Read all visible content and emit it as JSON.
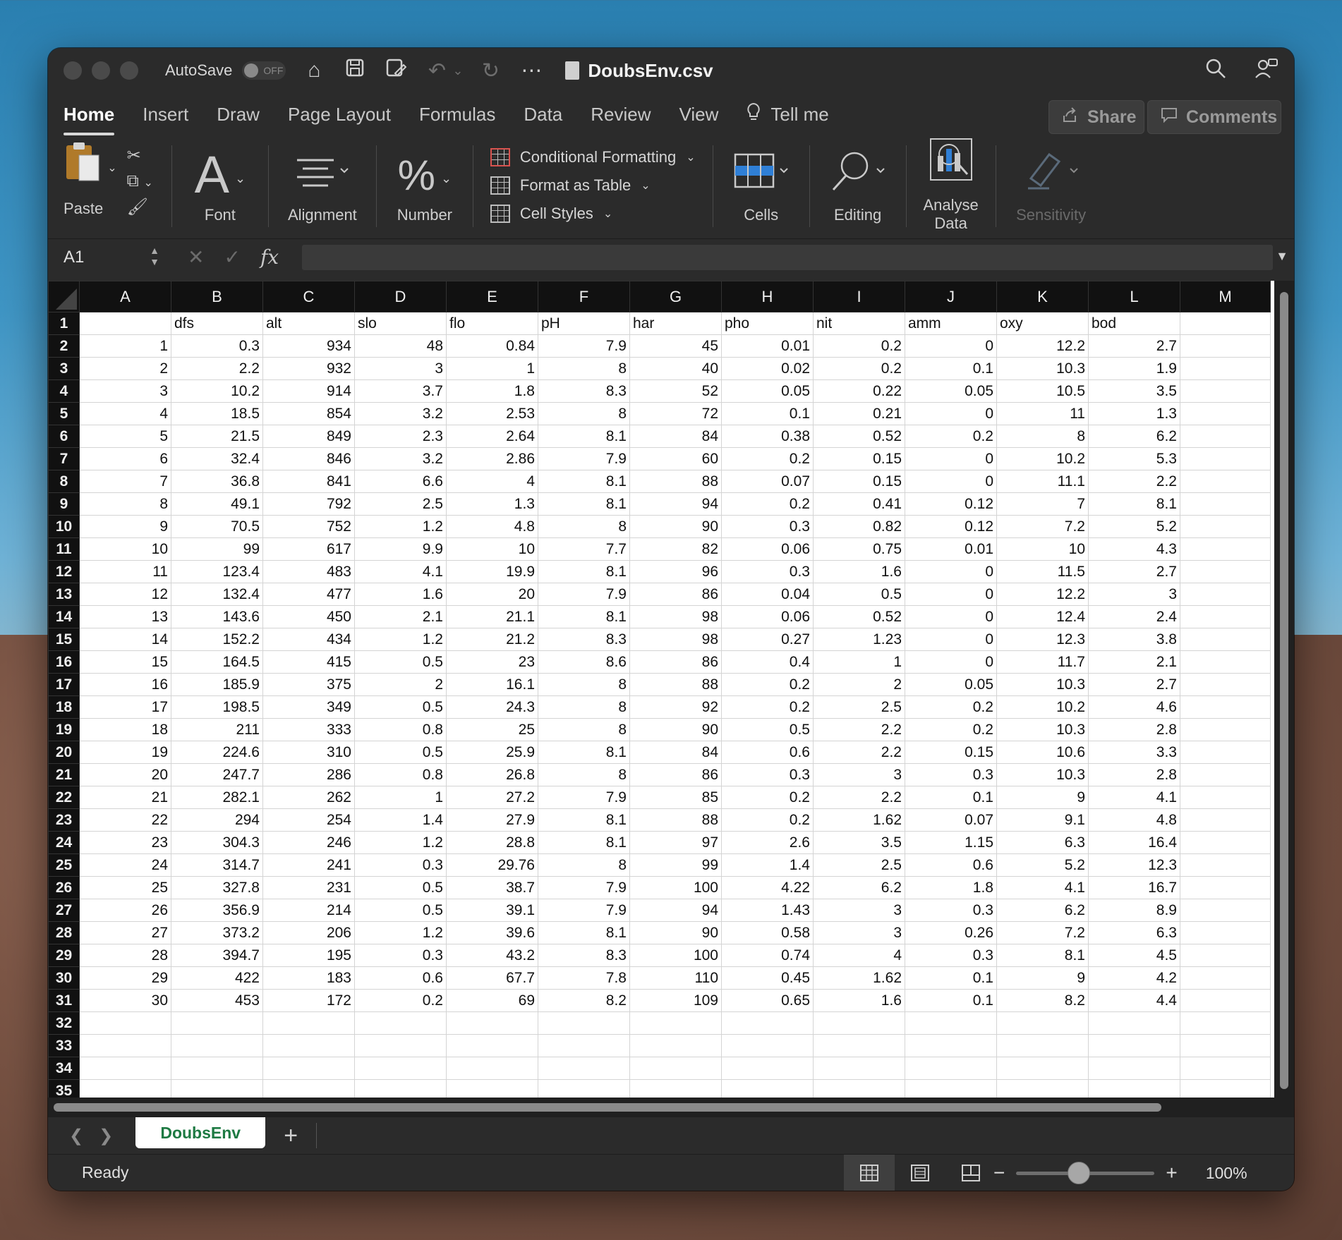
{
  "title_bar": {
    "autosave_label": "AutoSave",
    "autosave_state": "OFF",
    "document_title": "DoubsEnv.csv"
  },
  "ribbon_tabs": [
    "Home",
    "Insert",
    "Draw",
    "Page Layout",
    "Formulas",
    "Data",
    "Review",
    "View"
  ],
  "tell_me": "Tell me",
  "share_label": "Share",
  "comments_label": "Comments",
  "ribbon": {
    "paste": "Paste",
    "font": "Font",
    "alignment": "Alignment",
    "number": "Number",
    "conditional_formatting": "Conditional Formatting",
    "format_as_table": "Format as Table",
    "cell_styles": "Cell Styles",
    "cells": "Cells",
    "editing": "Editing",
    "analyse_data_line1": "Analyse",
    "analyse_data_line2": "Data",
    "sensitivity": "Sensitivity"
  },
  "formula_bar": {
    "name_box": "A1",
    "formula": ""
  },
  "columns": [
    "A",
    "B",
    "C",
    "D",
    "E",
    "F",
    "G",
    "H",
    "I",
    "J",
    "K",
    "L",
    "M"
  ],
  "header_row": [
    "",
    "dfs",
    "alt",
    "slo",
    "flo",
    "pH",
    "har",
    "pho",
    "nit",
    "amm",
    "oxy",
    "bod",
    ""
  ],
  "rows": [
    [
      "1",
      "0.3",
      "934",
      "48",
      "0.84",
      "7.9",
      "45",
      "0.01",
      "0.2",
      "0",
      "12.2",
      "2.7"
    ],
    [
      "2",
      "2.2",
      "932",
      "3",
      "1",
      "8",
      "40",
      "0.02",
      "0.2",
      "0.1",
      "10.3",
      "1.9"
    ],
    [
      "3",
      "10.2",
      "914",
      "3.7",
      "1.8",
      "8.3",
      "52",
      "0.05",
      "0.22",
      "0.05",
      "10.5",
      "3.5"
    ],
    [
      "4",
      "18.5",
      "854",
      "3.2",
      "2.53",
      "8",
      "72",
      "0.1",
      "0.21",
      "0",
      "11",
      "1.3"
    ],
    [
      "5",
      "21.5",
      "849",
      "2.3",
      "2.64",
      "8.1",
      "84",
      "0.38",
      "0.52",
      "0.2",
      "8",
      "6.2"
    ],
    [
      "6",
      "32.4",
      "846",
      "3.2",
      "2.86",
      "7.9",
      "60",
      "0.2",
      "0.15",
      "0",
      "10.2",
      "5.3"
    ],
    [
      "7",
      "36.8",
      "841",
      "6.6",
      "4",
      "8.1",
      "88",
      "0.07",
      "0.15",
      "0",
      "11.1",
      "2.2"
    ],
    [
      "8",
      "49.1",
      "792",
      "2.5",
      "1.3",
      "8.1",
      "94",
      "0.2",
      "0.41",
      "0.12",
      "7",
      "8.1"
    ],
    [
      "9",
      "70.5",
      "752",
      "1.2",
      "4.8",
      "8",
      "90",
      "0.3",
      "0.82",
      "0.12",
      "7.2",
      "5.2"
    ],
    [
      "10",
      "99",
      "617",
      "9.9",
      "10",
      "7.7",
      "82",
      "0.06",
      "0.75",
      "0.01",
      "10",
      "4.3"
    ],
    [
      "11",
      "123.4",
      "483",
      "4.1",
      "19.9",
      "8.1",
      "96",
      "0.3",
      "1.6",
      "0",
      "11.5",
      "2.7"
    ],
    [
      "12",
      "132.4",
      "477",
      "1.6",
      "20",
      "7.9",
      "86",
      "0.04",
      "0.5",
      "0",
      "12.2",
      "3"
    ],
    [
      "13",
      "143.6",
      "450",
      "2.1",
      "21.1",
      "8.1",
      "98",
      "0.06",
      "0.52",
      "0",
      "12.4",
      "2.4"
    ],
    [
      "14",
      "152.2",
      "434",
      "1.2",
      "21.2",
      "8.3",
      "98",
      "0.27",
      "1.23",
      "0",
      "12.3",
      "3.8"
    ],
    [
      "15",
      "164.5",
      "415",
      "0.5",
      "23",
      "8.6",
      "86",
      "0.4",
      "1",
      "0",
      "11.7",
      "2.1"
    ],
    [
      "16",
      "185.9",
      "375",
      "2",
      "16.1",
      "8",
      "88",
      "0.2",
      "2",
      "0.05",
      "10.3",
      "2.7"
    ],
    [
      "17",
      "198.5",
      "349",
      "0.5",
      "24.3",
      "8",
      "92",
      "0.2",
      "2.5",
      "0.2",
      "10.2",
      "4.6"
    ],
    [
      "18",
      "211",
      "333",
      "0.8",
      "25",
      "8",
      "90",
      "0.5",
      "2.2",
      "0.2",
      "10.3",
      "2.8"
    ],
    [
      "19",
      "224.6",
      "310",
      "0.5",
      "25.9",
      "8.1",
      "84",
      "0.6",
      "2.2",
      "0.15",
      "10.6",
      "3.3"
    ],
    [
      "20",
      "247.7",
      "286",
      "0.8",
      "26.8",
      "8",
      "86",
      "0.3",
      "3",
      "0.3",
      "10.3",
      "2.8"
    ],
    [
      "21",
      "282.1",
      "262",
      "1",
      "27.2",
      "7.9",
      "85",
      "0.2",
      "2.2",
      "0.1",
      "9",
      "4.1"
    ],
    [
      "22",
      "294",
      "254",
      "1.4",
      "27.9",
      "8.1",
      "88",
      "0.2",
      "1.62",
      "0.07",
      "9.1",
      "4.8"
    ],
    [
      "23",
      "304.3",
      "246",
      "1.2",
      "28.8",
      "8.1",
      "97",
      "2.6",
      "3.5",
      "1.15",
      "6.3",
      "16.4"
    ],
    [
      "24",
      "314.7",
      "241",
      "0.3",
      "29.76",
      "8",
      "99",
      "1.4",
      "2.5",
      "0.6",
      "5.2",
      "12.3"
    ],
    [
      "25",
      "327.8",
      "231",
      "0.5",
      "38.7",
      "7.9",
      "100",
      "4.22",
      "6.2",
      "1.8",
      "4.1",
      "16.7"
    ],
    [
      "26",
      "356.9",
      "214",
      "0.5",
      "39.1",
      "7.9",
      "94",
      "1.43",
      "3",
      "0.3",
      "6.2",
      "8.9"
    ],
    [
      "27",
      "373.2",
      "206",
      "1.2",
      "39.6",
      "8.1",
      "90",
      "0.58",
      "3",
      "0.26",
      "7.2",
      "6.3"
    ],
    [
      "28",
      "394.7",
      "195",
      "0.3",
      "43.2",
      "8.3",
      "100",
      "0.74",
      "4",
      "0.3",
      "8.1",
      "4.5"
    ],
    [
      "29",
      "422",
      "183",
      "0.6",
      "67.7",
      "7.8",
      "110",
      "0.45",
      "1.62",
      "0.1",
      "9",
      "4.2"
    ],
    [
      "30",
      "453",
      "172",
      "0.2",
      "69",
      "8.2",
      "109",
      "0.65",
      "1.6",
      "0.1",
      "8.2",
      "4.4"
    ]
  ],
  "row_numbers": [
    "1",
    "2",
    "3",
    "4",
    "5",
    "6",
    "7",
    "8",
    "9",
    "10",
    "11",
    "12",
    "13",
    "14",
    "15",
    "16",
    "17",
    "18",
    "19",
    "20",
    "21",
    "22",
    "23",
    "24",
    "25",
    "26",
    "27",
    "28",
    "29",
    "30",
    "31",
    "32",
    "33",
    "34",
    "35"
  ],
  "sheet_tab": "DoubsEnv",
  "status": "Ready",
  "zoom_level": "100%",
  "zoom_fraction": 0.45,
  "colors": {
    "sheet_tab_text": "#1e7a43",
    "window_bg": "#2b2b2b",
    "header_bg": "#111111"
  }
}
